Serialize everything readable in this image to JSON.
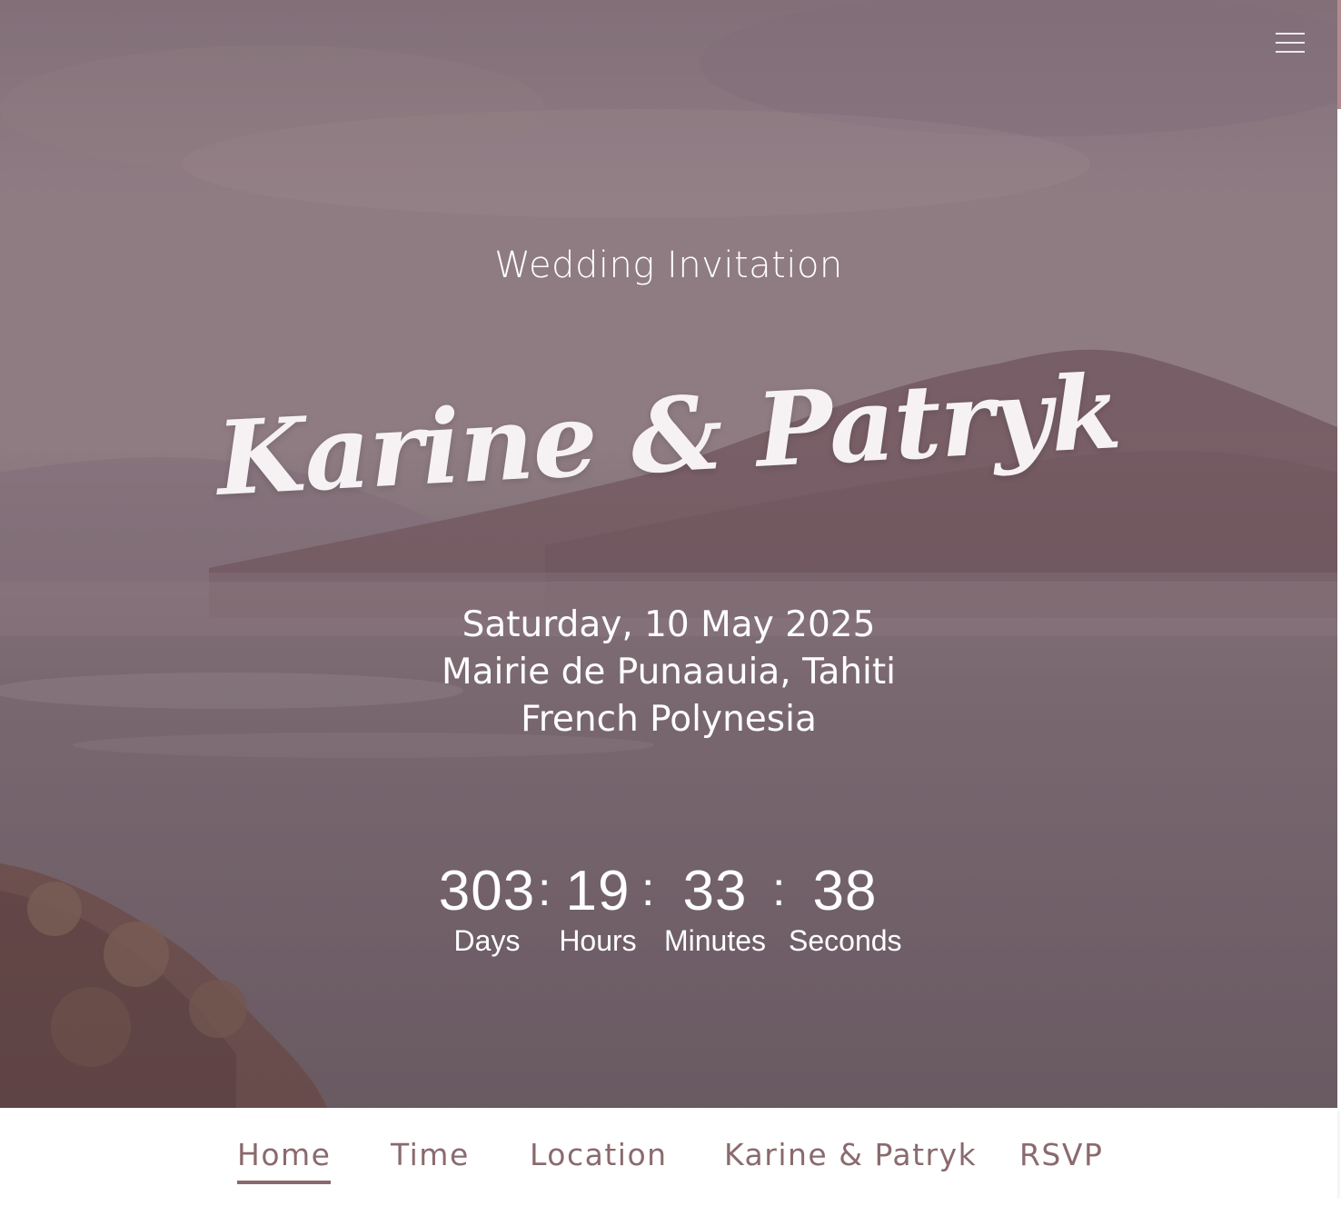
{
  "hero": {
    "subtitle": "Wedding Invitation",
    "names": "Karine & Patryk",
    "date": "Saturday, 10 May 2025",
    "venue": "Mairie de Punaauia, Tahiti",
    "region": "French Polynesia",
    "menu_icon": "hamburger-menu-icon"
  },
  "countdown": {
    "days": "303",
    "days_label": "Days",
    "hours": "19",
    "hours_label": "Hours",
    "minutes": "33",
    "minutes_label": "Minutes",
    "seconds": "38",
    "seconds_label": "Seconds",
    "separator": ":"
  },
  "nav": {
    "items": [
      {
        "label": "Home",
        "active": true
      },
      {
        "label": "Time",
        "active": false
      },
      {
        "label": "Location",
        "active": false
      },
      {
        "label": "Karine & Patryk",
        "active": false
      },
      {
        "label": "RSVP",
        "active": false
      }
    ]
  },
  "colors": {
    "accent": "#8a6a6e",
    "text_light": "#ffffff",
    "overlay": "#7e6d75"
  }
}
